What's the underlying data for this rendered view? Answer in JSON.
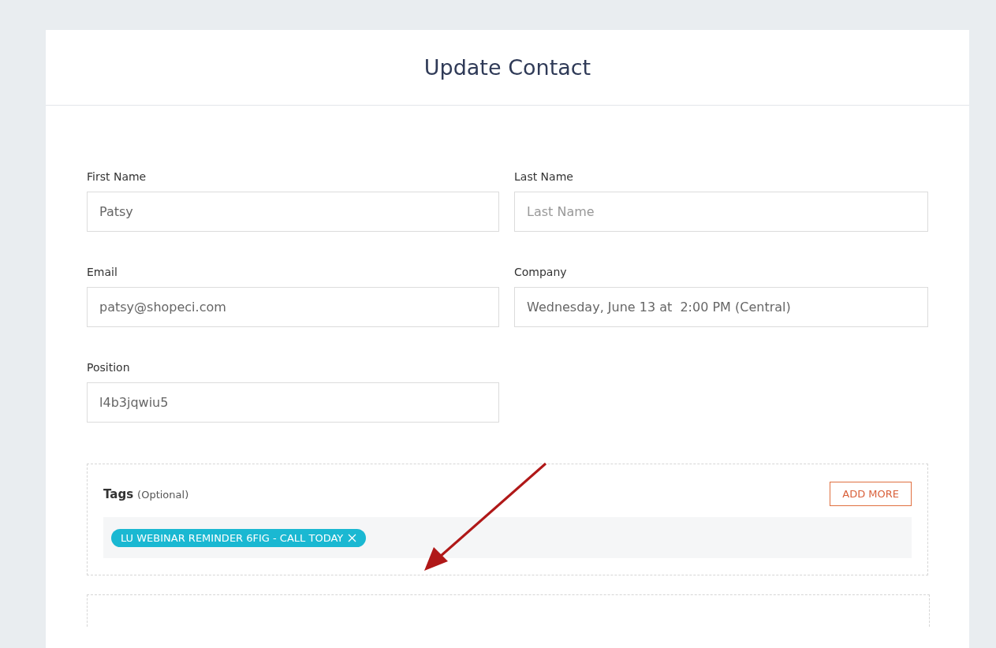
{
  "title": "Update Contact",
  "fields": [
    {
      "label": "First Name",
      "value": "Patsy"
    },
    {
      "label": "Last Name",
      "placeholder": "Last Name"
    },
    {
      "label": "Email",
      "value": "patsy@shopeci.com"
    },
    {
      "label": "Company",
      "value": "Wednesday, June 13 at  2:00 PM (Central)"
    },
    {
      "label": "Position",
      "value": "l4b3jqwiu5"
    }
  ],
  "tags": {
    "title": "Tags",
    "note": "(Optional)",
    "add_button": "ADD MORE",
    "items": [
      {
        "label": "LU WEBINAR REMINDER 6FIG - CALL TODAY"
      }
    ]
  }
}
